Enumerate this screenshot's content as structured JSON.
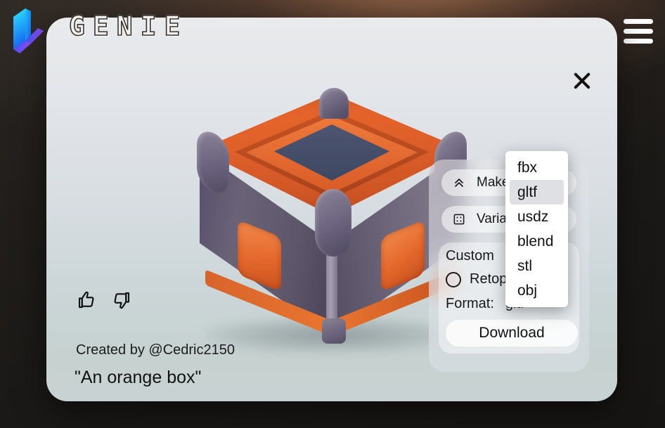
{
  "brand": {
    "name": "GENIE",
    "logo_icon": "genie-isometric-l-logo",
    "logo_gradient_from": "#19e7ff",
    "logo_gradient_to": "#7b3cff"
  },
  "topbar": {
    "menu_icon": "hamburger-menu-icon"
  },
  "card": {
    "close_icon": "close-x-icon"
  },
  "viewer": {
    "model_description": "orange and dark-purple sci-fi crate",
    "accent_orange": "#e4682c",
    "accent_dark": "#5d5569"
  },
  "feedback": {
    "like_icon": "thumbs-up-icon",
    "dislike_icon": "thumbs-down-icon"
  },
  "caption": {
    "author": "Created by @Cedric2150",
    "prompt": "\"An orange box\""
  },
  "export_panel": {
    "make_button": {
      "label": "Make",
      "icon": "double-chevron-up-icon"
    },
    "variations_button": {
      "label": "Varia",
      "icon": "dice-variations-icon"
    },
    "custom_title": "Custom",
    "retopologize": {
      "label": "Retop",
      "icon": "radio-unchecked-icon",
      "checked": false
    },
    "format_label": "Format:",
    "format_value": "gltf",
    "format_stepper_icon": "up-down-chevron-icon",
    "download_label": "Download"
  },
  "format_dropdown": {
    "open": true,
    "selected": "gltf",
    "options": [
      "fbx",
      "gltf",
      "usdz",
      "blend",
      "stl",
      "obj"
    ]
  }
}
